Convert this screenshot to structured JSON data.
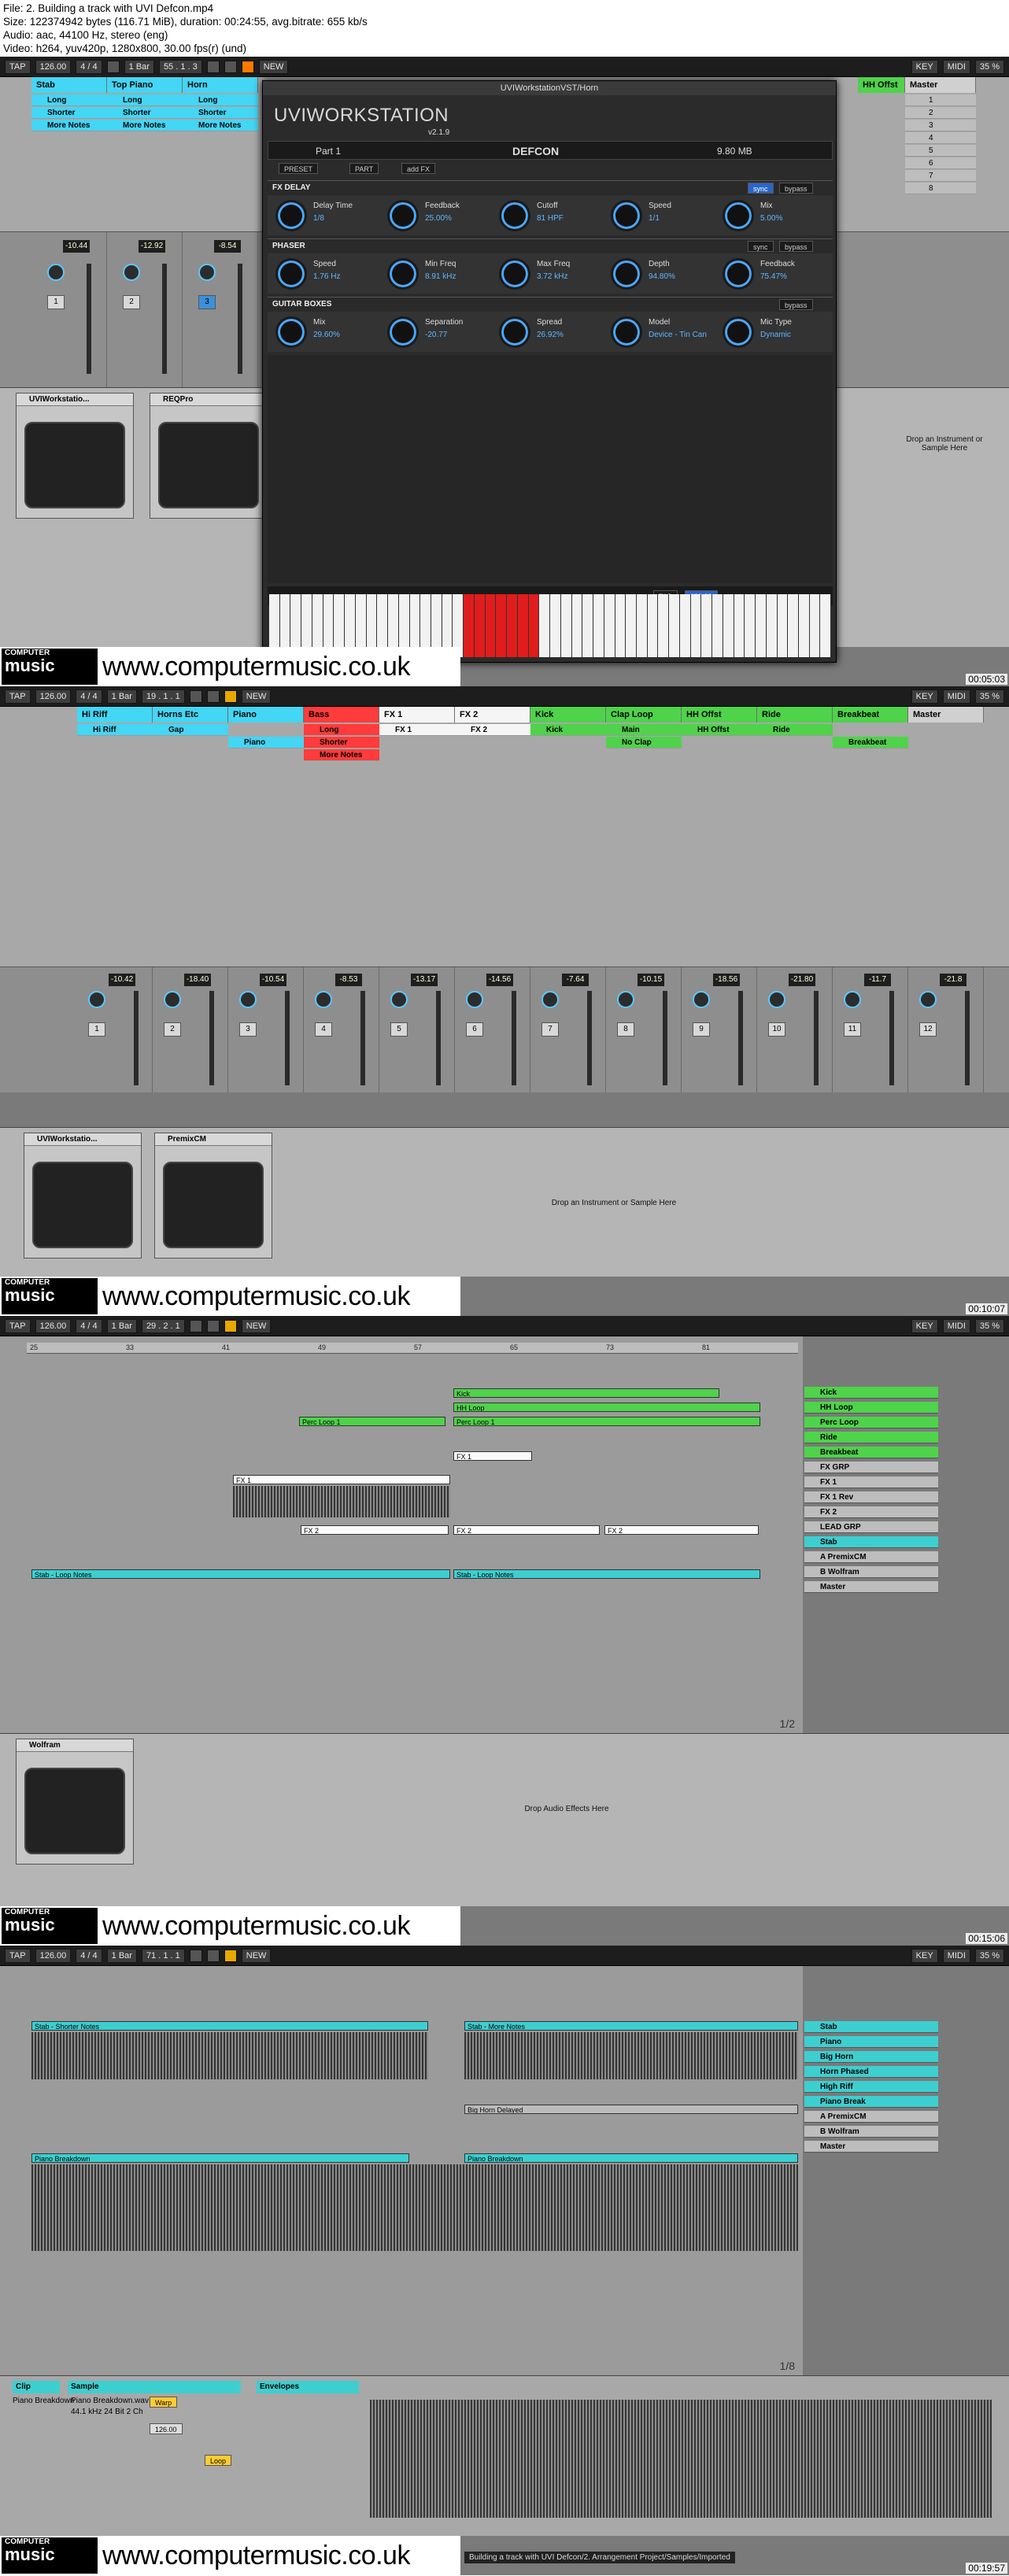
{
  "header": {
    "file": "File: 2. Building a track with UVI Defcon.mp4",
    "size": "Size: 122374942 bytes (116.71 MiB), duration: 00:24:55, avg.bitrate: 655 kb/s",
    "audio": "Audio: aac, 44100 Hz, stereo (eng)",
    "video": "Video: h264, yuv420p, 1280x800, 30.00 fps(r) (und)"
  },
  "watermark": {
    "logo_top": "COMPUTER",
    "logo_bottom": "music",
    "url": "www.computermusic.co.uk"
  },
  "transport": {
    "tap": "TAP",
    "tempo": "126.00",
    "sig": "4 / 4",
    "quant": "1 Bar",
    "nsw": "NEW",
    "key": "KEY",
    "midi": "MIDI",
    "cpu": "35 %"
  },
  "frame1": {
    "timecode": "00:05:03",
    "position": "55 . 1 . 3",
    "tracks": [
      "Stab",
      "Top Piano",
      "Horn"
    ],
    "clips_stab": [
      "Long",
      "Shorter",
      "More Notes"
    ],
    "master": [
      "HH Offst",
      "Master"
    ],
    "scenes": [
      "1",
      "2",
      "3",
      "4",
      "5",
      "6",
      "7",
      "8"
    ],
    "volumes": [
      "-10.44",
      "-12.92",
      "-8.54"
    ],
    "plugin": {
      "title": "UVIWorkstationVST/Horn",
      "logo": "UVIWORKSTATION",
      "version": "v2.1.9",
      "part": "Part 1",
      "preset_name": "DEFCON",
      "memory": "9.80 MB",
      "tabs": [
        "PRESET",
        "PART",
        "add FX"
      ],
      "fx_delay": {
        "title": "FX DELAY",
        "sync": "sync",
        "bypass": "bypass",
        "params": [
          {
            "l": "Delay Time",
            "v": "1/8"
          },
          {
            "l": "Feedback",
            "v": "25.00%"
          },
          {
            "l": "Cutoff",
            "v": "81 HPF"
          },
          {
            "l": "Speed",
            "v": "1/1"
          },
          {
            "l": "Mix",
            "v": "5.00%"
          }
        ]
      },
      "phaser": {
        "title": "PHASER",
        "sync": "sync",
        "bypass": "bypass",
        "params": [
          {
            "l": "Speed",
            "v": "1.76 Hz"
          },
          {
            "l": "Min Freq",
            "v": "8.91 kHz"
          },
          {
            "l": "Max Freq",
            "v": "3.72 kHz"
          },
          {
            "l": "Depth",
            "v": "94.80%"
          },
          {
            "l": "Feedback",
            "v": "75.47%"
          }
        ]
      },
      "guitar_boxes": {
        "title": "GUITAR BOXES",
        "bypass": "bypass",
        "params": [
          {
            "l": "Mix",
            "v": "29.60%"
          },
          {
            "l": "Separation",
            "v": "-20.77"
          },
          {
            "l": "Spread",
            "v": "26.92%"
          },
          {
            "l": "Model",
            "v": "Device - Tin Can"
          },
          {
            "l": "Mic Type",
            "v": "Dynamic"
          }
        ]
      },
      "tap": "TAP",
      "bpm": "126.00"
    },
    "devices": [
      "UVIWorkstatio...",
      "REQPro"
    ],
    "drop_text": "Drop an Instrument or Sample Here"
  },
  "frame2": {
    "timecode": "00:10:07",
    "position": "19 . 1 . 1",
    "tracks": [
      "Hi Riff",
      "Horns Etc",
      "Piano",
      "Bass",
      "FX 1",
      "FX 2",
      "Kick",
      "Clap Loop",
      "HH Offst",
      "Ride",
      "Breakbeat",
      "Master"
    ],
    "clips": [
      "Hi Riff",
      "Gap",
      "Piano",
      "Long",
      "Shorter",
      "More Notes",
      "FX 1",
      "FX 2",
      "Kick",
      "Main",
      "No Clap",
      "HH Offst",
      "Ride",
      "Breakbeat"
    ],
    "volumes": [
      "-10.42",
      "-18.40",
      "-10.54",
      "-8.53",
      "-13.17",
      "-14.56",
      "-7.64",
      "-10.15",
      "-18.56",
      "-21.80",
      "-11.7",
      "-21.8"
    ],
    "devices": [
      "UVIWorkstatio...",
      "PremixCM"
    ],
    "drop_text": "Drop an Instrument or Sample Here"
  },
  "frame3": {
    "timecode": "00:15:06",
    "position": "29 . 2 . 1",
    "ruler": [
      "25",
      "33",
      "41",
      "49",
      "57",
      "65",
      "73",
      "81"
    ],
    "clips": [
      "Kick",
      "HH Loop",
      "Perc Loop 1",
      "Perc Loop 1",
      "FX 1",
      "FX 1",
      "FX 2",
      "FX 2",
      "FX 2",
      "Stab - Loop Notes",
      "Stab - Loop Notes"
    ],
    "tracks": [
      "Kick",
      "HH Loop",
      "Perc Loop",
      "Ride",
      "Breakbeat",
      "FX GRP",
      "FX 1",
      "FX 1 Rev",
      "FX 2",
      "LEAD GRP",
      "Stab",
      "A PremixCM",
      "B Wolfram",
      "Master"
    ],
    "page": "1/2",
    "device": "Wolfram",
    "drop_text": "Drop Audio Effects Here"
  },
  "frame4": {
    "timecode": "00:19:57",
    "position": "71 . 1 . 1",
    "clips": [
      "Stab - Shorter Notes",
      "Stab - More Notes",
      "Big Horn Delayed",
      "Piano Breakdown",
      "Piano Breakdown"
    ],
    "tracks": [
      "Stab",
      "Piano",
      "Big Horn",
      "Horn Phased",
      "High Riff",
      "Piano Break",
      "A PremixCM",
      "B Wolfram",
      "Master"
    ],
    "page": "1/8",
    "clip_panel": {
      "clip": "Clip",
      "sample": "Sample",
      "envelopes": "Envelopes",
      "name": "Piano Breakdown",
      "file": "Piano Breakdown.wav",
      "info": "44.1 kHz 24 Bit 2 Ch",
      "bpm": "126.00",
      "warp": "Warp",
      "loop": "Loop"
    },
    "status": "Building a track with UVI Defcon/2. Arrangement Project/Samples/Imported"
  }
}
